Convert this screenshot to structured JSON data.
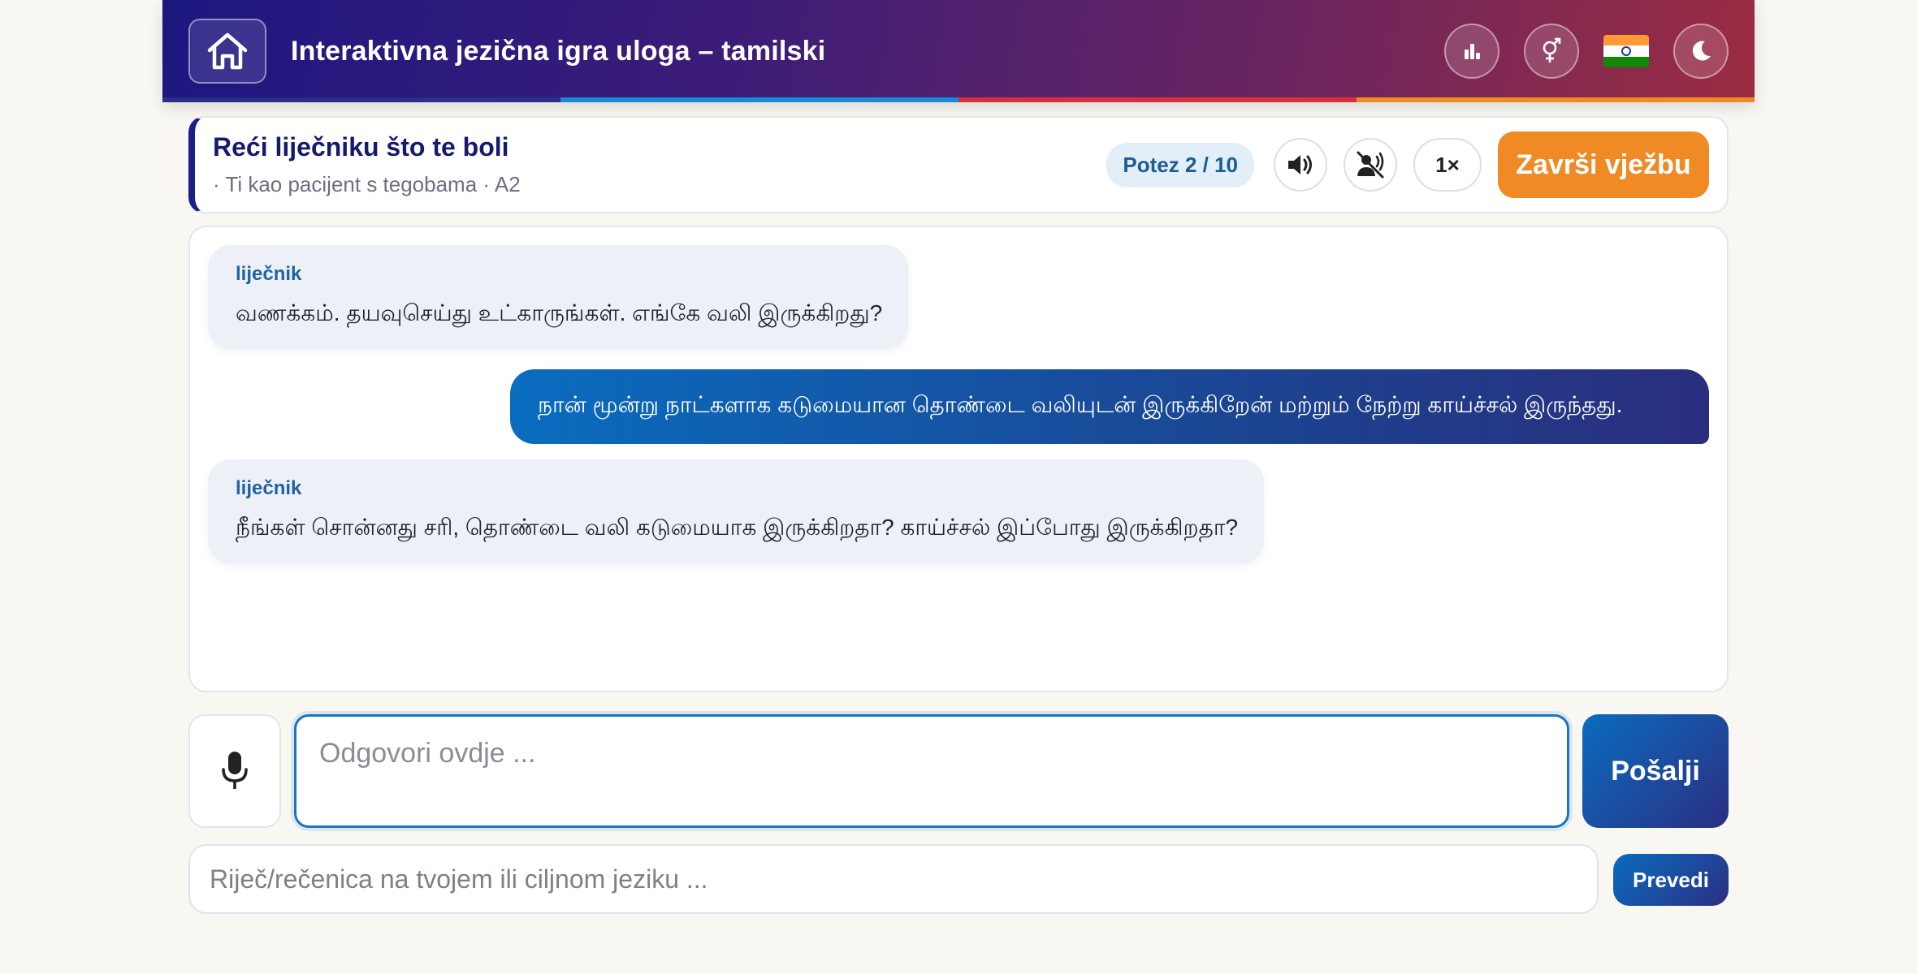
{
  "header": {
    "title": "Interaktivna jezična igra uloga – tamilski",
    "stripe_colors": [
      "#2a2d8a",
      "#1a8ad6",
      "#d92f3c",
      "#f08a24"
    ],
    "icons": [
      "home-icon",
      "stats-icon",
      "gender-icon",
      "india-flag-icon",
      "moon-icon"
    ]
  },
  "scenario": {
    "title": "Reći liječniku što te boli",
    "subtitle": "· Ti kao pacijent s tegobama · A2",
    "turn": "Potez 2 / 10",
    "speed": "1×",
    "finish_label": "Završi vježbu"
  },
  "chat": {
    "messages": [
      {
        "role": "bot",
        "speaker": "liječnik",
        "text": "வணக்கம். தயவுசெய்து உட்காருங்கள். எங்கே வலி இருக்கிறது?"
      },
      {
        "role": "user",
        "text": "நான் மூன்று நாட்களாக கடுமையான தொண்டை வலியுடன் இருக்கிறேன் மற்றும் நேற்று காய்ச்சல் இருந்தது."
      },
      {
        "role": "bot",
        "speaker": "liječnik",
        "text": "நீங்கள் சொன்னது சரி, தொண்டை வலி கடுமையாக இருக்கிறதா? காய்ச்சல் இப்போது இருக்கிறதா?"
      }
    ]
  },
  "input": {
    "reply_placeholder": "Odgovori ovdje ...",
    "send_label": "Pošalji",
    "translate_placeholder": "Riječ/rečenica na tvojem ili ciljnom jeziku ...",
    "translate_label": "Prevedi"
  },
  "colors": {
    "accent_orange": "#f08a24",
    "brand_navy": "#141a6e",
    "accent_blue": "#1a74c4"
  }
}
